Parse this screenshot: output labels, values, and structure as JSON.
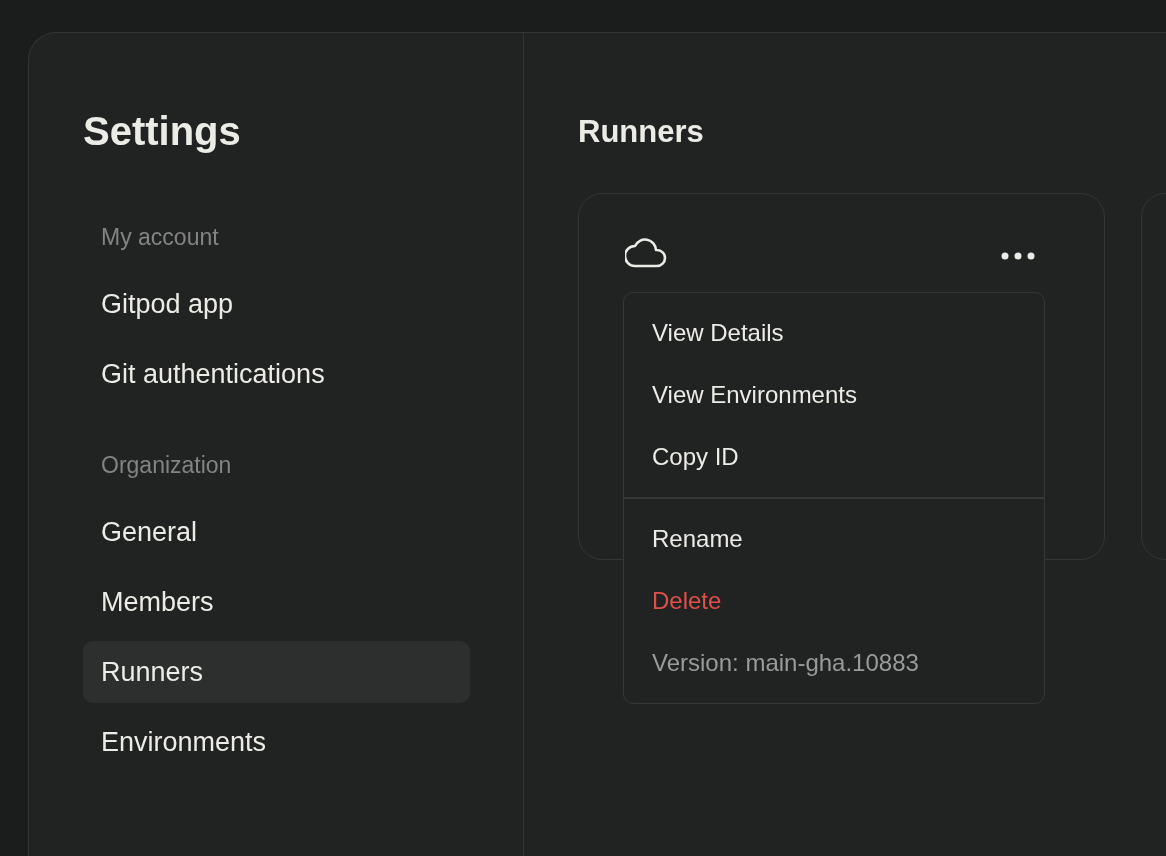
{
  "sidebar": {
    "title": "Settings",
    "sections": [
      {
        "label": "My account",
        "items": [
          {
            "label": "Gitpod app",
            "selected": false
          },
          {
            "label": "Git authentications",
            "selected": false
          }
        ]
      },
      {
        "label": "Organization",
        "items": [
          {
            "label": "General",
            "selected": false
          },
          {
            "label": "Members",
            "selected": false
          },
          {
            "label": "Runners",
            "selected": true
          },
          {
            "label": "Environments",
            "selected": false
          }
        ]
      }
    ]
  },
  "main": {
    "title": "Runners",
    "card": {
      "menu": {
        "groups": [
          [
            {
              "kind": "action",
              "label": "View Details"
            },
            {
              "kind": "action",
              "label": "View Environments"
            },
            {
              "kind": "action",
              "label": "Copy ID"
            }
          ],
          [
            {
              "kind": "action",
              "label": "Rename"
            },
            {
              "kind": "danger",
              "label": "Delete"
            },
            {
              "kind": "info",
              "label": "Version: main-gha.10883"
            }
          ]
        ]
      }
    }
  }
}
